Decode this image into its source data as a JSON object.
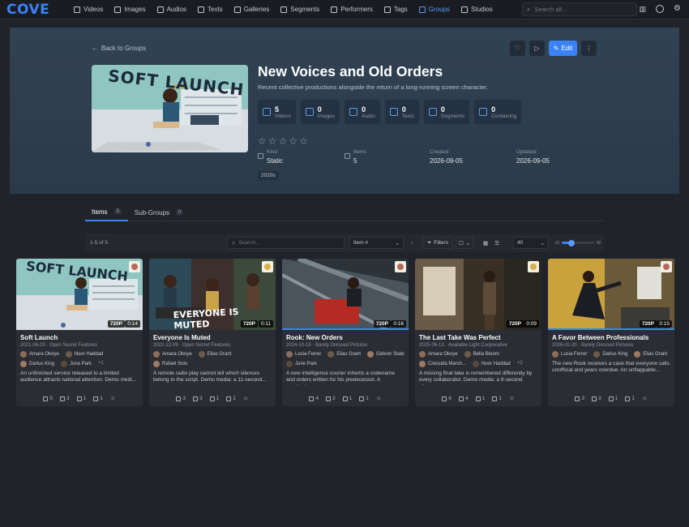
{
  "nav": {
    "logo": "COVE",
    "items": [
      {
        "label": "Videos",
        "icon": "video-icon",
        "active": false
      },
      {
        "label": "Images",
        "icon": "image-icon",
        "active": false
      },
      {
        "label": "Audios",
        "icon": "headphones-icon",
        "active": false
      },
      {
        "label": "Texts",
        "icon": "document-icon",
        "active": false
      },
      {
        "label": "Galleries",
        "icon": "gallery-icon",
        "active": false
      },
      {
        "label": "Segments",
        "icon": "bookmark-icon",
        "active": false
      },
      {
        "label": "Performers",
        "icon": "people-icon",
        "active": false
      },
      {
        "label": "Tags",
        "icon": "tag-icon",
        "active": false
      },
      {
        "label": "Groups",
        "icon": "layers-icon",
        "active": true
      },
      {
        "label": "Studios",
        "icon": "studio-icon",
        "active": false
      }
    ],
    "search_placeholder": "Search all..."
  },
  "hero": {
    "back_label": "Back to Groups",
    "edit_label": "Edit",
    "title": "New Voices and Old Orders",
    "subtitle": "Recent collective productions alongside the return of a long-running screen character.",
    "cover_text": "SOFT LAUNCH",
    "stats": [
      {
        "num": "5",
        "label": "Videos"
      },
      {
        "num": "0",
        "label": "Images"
      },
      {
        "num": "0",
        "label": "Audio"
      },
      {
        "num": "0",
        "label": "Texts"
      },
      {
        "num": "0",
        "label": "Segments"
      },
      {
        "num": "0",
        "label": "Containing"
      }
    ],
    "rating": 0,
    "meta": [
      {
        "label": "Kind",
        "value": "Static"
      },
      {
        "label": "Items",
        "value": "5"
      },
      {
        "label": "Created",
        "value": "2026-09-05"
      },
      {
        "label": "Updated",
        "value": "2026-09-05"
      }
    ],
    "tag": "2020s"
  },
  "tabs": [
    {
      "label": "Items",
      "count": "5",
      "active": true
    },
    {
      "label": "Sub-Groups",
      "count": "0",
      "active": false
    }
  ],
  "toolbar": {
    "count_text": "1-5 of 5",
    "search_placeholder": "Search...",
    "sort_value": "Item #",
    "filters_label": "Filters",
    "per_page": "40",
    "zoom_level": 0.3
  },
  "cards": [
    {
      "title": "Soft Launch",
      "date": "2021-04-23",
      "studio": "Open Secret Features",
      "resolution": "720P",
      "duration": "0:14",
      "thumb_text": "SOFT LAUNCH",
      "performers": [
        "Amara Okoye",
        "Noor Haddad",
        "Darius King",
        "June Park"
      ],
      "more": "+1",
      "description": "An unfinished service released to a limited audience attracts national attention. Demo medi...",
      "counts": {
        "performers": "5",
        "tags": "3",
        "groups": "1",
        "galleries": "1"
      },
      "progress": 0
    },
    {
      "title": "Everyone Is Muted",
      "date": "2022-12-09",
      "studio": "Open Secret Features",
      "resolution": "720P",
      "duration": "0:11",
      "thumb_text": "EVERYONE IS MUTED",
      "performers": [
        "Amara Okoye",
        "Elias Grant",
        "Rafael Soto"
      ],
      "more": "",
      "description": "A remote radio play cannot tell which silences belong to the script. Demo media: a 11-second...",
      "counts": {
        "performers": "3",
        "tags": "3",
        "groups": "1",
        "galleries": "1"
      },
      "progress": 0
    },
    {
      "title": "Rook: New Orders",
      "date": "2024-10-18",
      "studio": "Barely Dressed Pictures",
      "resolution": "720P",
      "duration": "0:16",
      "thumb_text": "",
      "performers": [
        "Lucia Ferrer",
        "Elias Grant",
        "Gideon Slate",
        "June Park"
      ],
      "more": "",
      "description": "A new intelligence courier inherits a codename and orders written for his predecessor. A practical...",
      "counts": {
        "performers": "4",
        "tags": "3",
        "groups": "1",
        "galleries": "1"
      },
      "progress": 1
    },
    {
      "title": "The Last Take Was Perfect",
      "date": "2025-06-13",
      "studio": "Available Light Cooperative",
      "resolution": "720P",
      "duration": "0:09",
      "thumb_text": "",
      "performers": [
        "Amara Okoye",
        "Bella Bloom",
        "Cressida Marsh...",
        "Noor Haddad"
      ],
      "more": "+2",
      "description": "A missing final take is remembered differently by every collaborator. Demo media: a 9-second silen...",
      "counts": {
        "performers": "6",
        "tags": "4",
        "groups": "1",
        "galleries": "1"
      },
      "progress": 0
    },
    {
      "title": "A Favor Between Professionals",
      "date": "2026-02-20",
      "studio": "Barely Dressed Pictures",
      "resolution": "720P",
      "duration": "0:15",
      "thumb_text": "",
      "performers": [
        "Lucia Ferrer",
        "Darius King",
        "Elias Grant"
      ],
      "more": "",
      "description": "The new Rook receives a case that everyone calls unofficial and years overdue. An unflappable...",
      "counts": {
        "performers": "3",
        "tags": "3",
        "groups": "1",
        "galleries": "1"
      },
      "progress": 1
    }
  ]
}
